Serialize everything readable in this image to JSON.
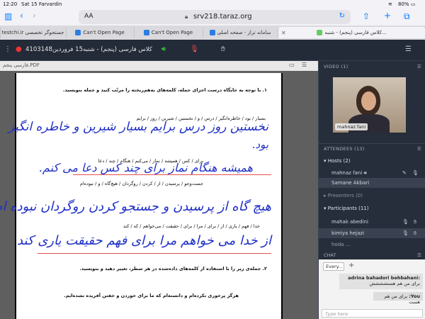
{
  "status": {
    "time": "12:20",
    "date": "Sat 15 Farvardin",
    "battery": "80%"
  },
  "browser": {
    "text_size": "AA",
    "url": "srv218.taraz.org",
    "tabs": [
      {
        "label": "testchi.ir جستجوگر تخصصی"
      },
      {
        "label": "Can't Open Page"
      },
      {
        "label": "Can't Open Page"
      },
      {
        "label": "سامانه تراز - صفحه اصلی"
      },
      {
        "label": "کلاس فارسی (پنجم) - شنبه..."
      }
    ]
  },
  "meeting": {
    "title": "کلاس فارسی (پنجم) - شنبه15 فروردین4103148"
  },
  "presentation": {
    "filename": "فارسی پنجم.PDF",
    "q1": "۱. با توجه به جایگاه درست اجزای جمله، کلمه‌های به‌هم‌ریخته را مرتّب کنید و جمله بنویسید.",
    "w1": "بسیار / بود / خاطره‌انگیز / درس / و / نخستین / شیرین / روز / برایم",
    "w2": "برای / کس / همیشه / نماز / می‌کنم / هنگام / چند / دعا",
    "w3": "جست‌وجو / پرسیدن / از / کردن / روگردان / هیچ‌گاه / و / نبوده‌ام",
    "w4": "خدا / فهم / یاری / از / برای / مرا / برای / حقیقت / می‌خواهم / که / کند",
    "q2": "۲. جمله‌ی زیر را با استفاده از کلمه‌های داده‌شده در هر سطر، تغییر دهید و بنویسید.",
    "s2": "هرگز پرخوری نکرده‌ام و دانسته‌ام که ما برای خوردن و خفتن آفریده نشده‌ایم.",
    "hw1": "نخستین روز درس برایم بسیار شیرین و خاطره انگیز",
    "hw1b": "بود.",
    "hw2": "همیشه هنگام نماز برای چند کس دعا می کنم.",
    "hw3": "هیچ گاه از پرسیدن و جستجو کردن روگردان نبوده ام",
    "hw4": "از خدا می خواهم مرا برای فهم حقیقت یاری کند"
  },
  "video": {
    "header": "VIDEO (1)",
    "participant": "mahnaz fani"
  },
  "attendees": {
    "header": "ATTENDEES (13)",
    "hosts_label": "Hosts (2)",
    "hosts": [
      "mahnaz fani",
      "Samane Akbari"
    ],
    "presenters_label": "Presenters (0)",
    "participants_label": "Participants (11)",
    "participants": [
      "mahak abedini",
      "kimiya hejazi",
      "hoda ..."
    ]
  },
  "chat": {
    "header": "CHAT",
    "tab": "Every...",
    "msg1_name": "adrina bahadori behbahani:",
    "msg1_text": "برای من هم هستشششش",
    "msg2_name": "You:",
    "msg2_text": "برای من هم هست",
    "input_placeholder": "Type here"
  }
}
